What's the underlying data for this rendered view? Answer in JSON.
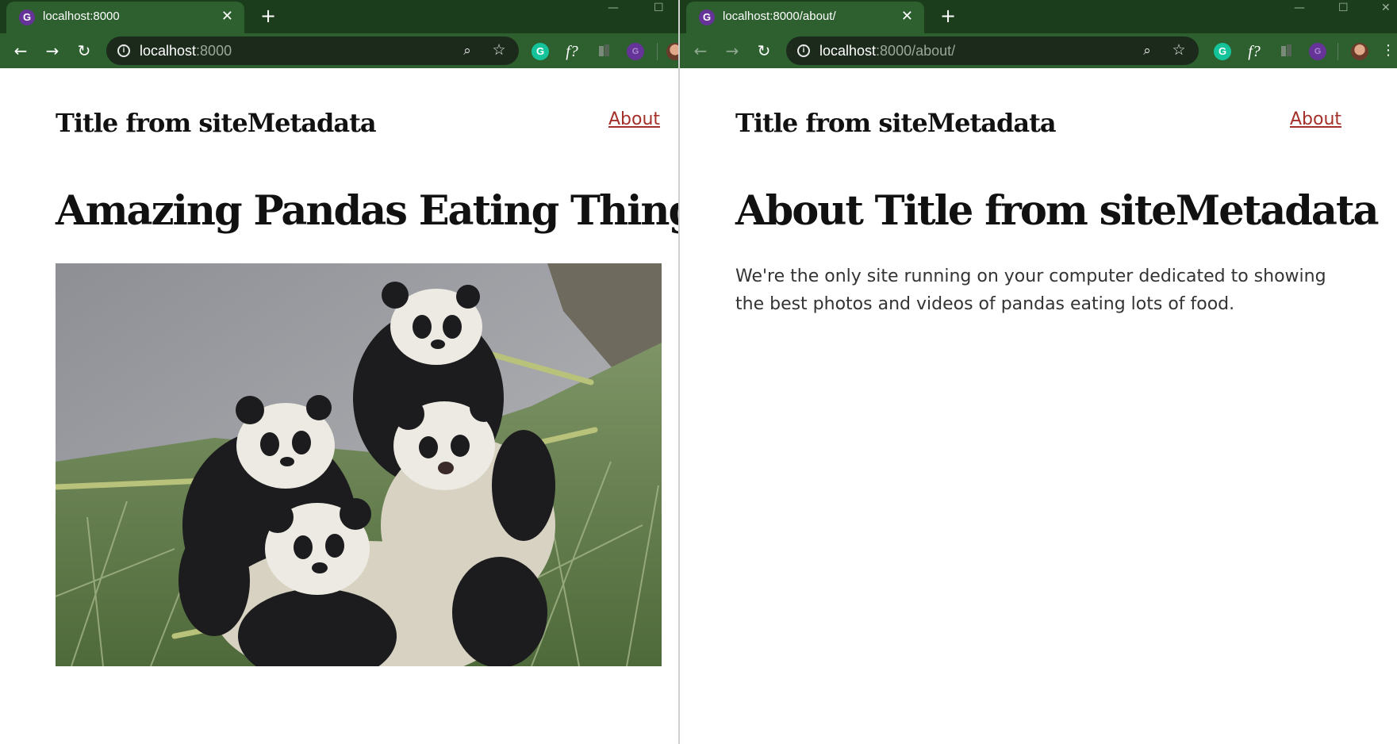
{
  "left_window": {
    "tab": {
      "title": "localhost:8000",
      "favicon": "gatsby-icon",
      "close_glyph": "✕"
    },
    "new_tab_glyph": "+",
    "address_bar": {
      "host": "localhost",
      "rest": ":8000"
    },
    "page": {
      "site_title": "Title from siteMetadata",
      "nav_about": "About",
      "heading": "Amazing Pandas Eating Things",
      "image": {
        "subject": "pandas eating bamboo photo"
      }
    }
  },
  "right_window": {
    "tab": {
      "title": "localhost:8000/about/",
      "favicon": "gatsby-icon",
      "close_glyph": "✕"
    },
    "new_tab_glyph": "+",
    "address_bar": {
      "host": "localhost",
      "rest": ":8000/about/"
    },
    "page": {
      "site_title": "Title from siteMetadata",
      "nav_about": "About",
      "heading": "About Title from siteMetadata",
      "body": "We're the only site running on your computer dedicated to showing the best photos and videos of pandas eating lots of food."
    }
  },
  "extensions": [
    "grammarly-icon",
    "function-icon",
    "extension-icon",
    "gatsby-icon",
    "profile-avatar"
  ],
  "colors": {
    "tabstrip": "#1b3d1b",
    "toolbar": "#2d5f2f",
    "omnibox": "#1b2a1b",
    "link": "#a4302a",
    "text": "#111111"
  }
}
